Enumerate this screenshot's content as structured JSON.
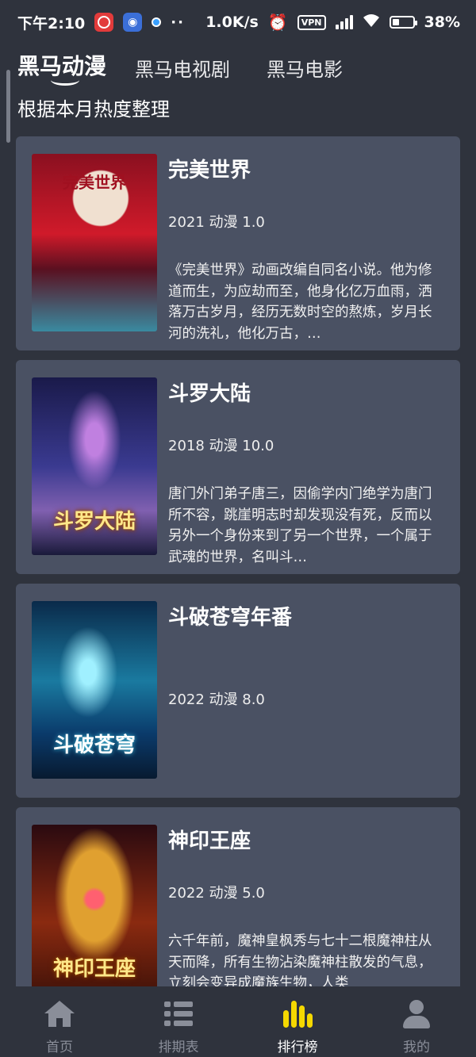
{
  "status_bar": {
    "time": "下午2:10",
    "speed": "1.0K/s",
    "vpn": "VPN",
    "battery": "38%",
    "icons": [
      "netease-music-icon",
      "cat-app-icon",
      "chat-bubble-icon",
      "more-dots-icon",
      "alarm-icon",
      "vpn-icon",
      "hd-signal-icon",
      "wifi-icon",
      "battery-icon"
    ]
  },
  "tabs": [
    {
      "label": "黑马动漫",
      "active": true
    },
    {
      "label": "黑马电视剧",
      "active": false
    },
    {
      "label": "黑马电影",
      "active": false
    }
  ],
  "subtitle": "根据本月热度整理",
  "items": [
    {
      "title": "完美世界",
      "meta": "2021 动漫 1.0",
      "description": "《完美世界》动画改编自同名小说。他为修道而生，为应劫而至，他身化亿万血雨，洒落万古岁月，经历无数时空的熬炼，岁月长河的洗礼，他化万古，…",
      "poster_text": "完美世界",
      "poster_colors": [
        "#8a1020",
        "#d01a2a",
        "#3a8aa0"
      ]
    },
    {
      "title": "斗罗大陆",
      "meta": "2018 动漫 10.0",
      "description": "唐门外门弟子唐三，因偷学内门绝学为唐门所不容，跳崖明志时却发现没有死，反而以另外一个身份来到了另一个世界，一个属于武魂的世界，名叫斗…",
      "poster_text": "斗罗大陆",
      "poster_colors": [
        "#1a1a4a",
        "#3a3a90",
        "#b070c0"
      ]
    },
    {
      "title": "斗破苍穹年番",
      "meta": "2022 动漫 8.0",
      "description": "",
      "poster_text": "斗破苍穹",
      "poster_colors": [
        "#0a2a4a",
        "#1a7aa0",
        "#40c0e0"
      ]
    },
    {
      "title": "神印王座",
      "meta": "2022 动漫 5.0",
      "description": "六千年前，魔神皇枫秀与七十二根魔神柱从天而降，所有生物沾染魔神柱散发的气息，立刻会变异成魔族生物，人类",
      "poster_text": "神印王座",
      "poster_colors": [
        "#2a0a10",
        "#8a2a10",
        "#e0a030"
      ]
    }
  ],
  "bottom_nav": [
    {
      "label": "首页",
      "icon": "home-icon",
      "active": false
    },
    {
      "label": "排期表",
      "icon": "list-icon",
      "active": false
    },
    {
      "label": "排行榜",
      "icon": "bar-chart-icon",
      "active": true
    },
    {
      "label": "我的",
      "icon": "user-icon",
      "active": false
    }
  ]
}
